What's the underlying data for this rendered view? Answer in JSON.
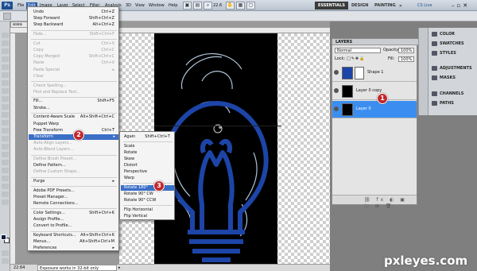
{
  "menubar": {
    "logo": "Ps",
    "items": [
      "File",
      "Edit",
      "Image",
      "Layer",
      "Select",
      "Filter",
      "Analysis",
      "3D",
      "View",
      "Window",
      "Help"
    ],
    "zoom": "22.6",
    "workspaces": [
      "ESSENTIALS",
      "DESIGN",
      "PAINTING"
    ],
    "cslive": "CS Live"
  },
  "document": {
    "tab": "asea",
    "status_zoom": "22.64",
    "status_text": "Exposure works in 32-bit only"
  },
  "edit_menu": {
    "items": [
      {
        "label": "Undo",
        "shortcut": "Ctrl+Z",
        "state": "normal"
      },
      {
        "label": "Step Forward",
        "shortcut": "Shift+Ctrl+Z",
        "state": "normal"
      },
      {
        "label": "Step Backward",
        "shortcut": "Alt+Ctrl+Z",
        "state": "normal"
      },
      {
        "label": "Fade...",
        "shortcut": "Shift+Ctrl+F",
        "state": "disabled"
      },
      {
        "label": "Cut",
        "shortcut": "Ctrl+X",
        "state": "disabled"
      },
      {
        "label": "Copy",
        "shortcut": "Ctrl+C",
        "state": "disabled"
      },
      {
        "label": "Copy Merged",
        "shortcut": "Shift+Ctrl+C",
        "state": "disabled"
      },
      {
        "label": "Paste",
        "shortcut": "Ctrl+V",
        "state": "disabled"
      },
      {
        "label": "Paste Special",
        "shortcut": "▸",
        "state": "disabled"
      },
      {
        "label": "Clear",
        "shortcut": "",
        "state": "disabled"
      },
      {
        "label": "Check Spelling...",
        "shortcut": "",
        "state": "disabled"
      },
      {
        "label": "Find and Replace Text...",
        "shortcut": "",
        "state": "disabled"
      },
      {
        "label": "Fill...",
        "shortcut": "Shift+F5",
        "state": "normal"
      },
      {
        "label": "Stroke...",
        "shortcut": "",
        "state": "normal"
      },
      {
        "label": "Content-Aware Scale",
        "shortcut": "Alt+Shift+Ctrl+C",
        "state": "normal"
      },
      {
        "label": "Puppet Warp",
        "shortcut": "",
        "state": "normal"
      },
      {
        "label": "Free Transform",
        "shortcut": "Ctrl+T",
        "state": "normal"
      },
      {
        "label": "Transform",
        "shortcut": "▸",
        "state": "highlight"
      },
      {
        "label": "Auto-Align Layers...",
        "shortcut": "",
        "state": "disabled"
      },
      {
        "label": "Auto-Blend Layers...",
        "shortcut": "",
        "state": "disabled"
      },
      {
        "label": "Define Brush Preset...",
        "shortcut": "",
        "state": "disabled"
      },
      {
        "label": "Define Pattern...",
        "shortcut": "",
        "state": "normal"
      },
      {
        "label": "Define Custom Shape...",
        "shortcut": "",
        "state": "disabled"
      },
      {
        "label": "Purge",
        "shortcut": "▸",
        "state": "normal"
      },
      {
        "label": "Adobe PDF Presets...",
        "shortcut": "",
        "state": "normal"
      },
      {
        "label": "Preset Manager...",
        "shortcut": "",
        "state": "normal"
      },
      {
        "label": "Remote Connections...",
        "shortcut": "",
        "state": "normal"
      },
      {
        "label": "Color Settings...",
        "shortcut": "Shift+Ctrl+K",
        "state": "normal"
      },
      {
        "label": "Assign Profile...",
        "shortcut": "",
        "state": "normal"
      },
      {
        "label": "Convert to Profile...",
        "shortcut": "",
        "state": "normal"
      },
      {
        "label": "Keyboard Shortcuts...",
        "shortcut": "Alt+Shift+Ctrl+K",
        "state": "normal"
      },
      {
        "label": "Menus...",
        "shortcut": "Alt+Shift+Ctrl+M",
        "state": "normal"
      },
      {
        "label": "Preferences",
        "shortcut": "▸",
        "state": "normal"
      }
    ]
  },
  "transform_menu": {
    "items": [
      {
        "label": "Again",
        "shortcut": "Shift+Ctrl+T",
        "state": "normal"
      },
      {
        "label": "Scale",
        "shortcut": "",
        "state": "normal"
      },
      {
        "label": "Rotate",
        "shortcut": "",
        "state": "normal"
      },
      {
        "label": "Skew",
        "shortcut": "",
        "state": "normal"
      },
      {
        "label": "Distort",
        "shortcut": "",
        "state": "normal"
      },
      {
        "label": "Perspective",
        "shortcut": "",
        "state": "normal"
      },
      {
        "label": "Warp",
        "shortcut": "",
        "state": "normal"
      },
      {
        "label": "Rotate 180°",
        "shortcut": "",
        "state": "highlight"
      },
      {
        "label": "Rotate 90° CW",
        "shortcut": "",
        "state": "normal"
      },
      {
        "label": "Rotate 90° CCW",
        "shortcut": "",
        "state": "normal"
      },
      {
        "label": "Flip Horizontal",
        "shortcut": "",
        "state": "normal"
      },
      {
        "label": "Flip Vertical",
        "shortcut": "",
        "state": "normal"
      }
    ]
  },
  "layers_panel": {
    "tab": "LAYERS",
    "blend_mode": "Normal",
    "opacity_label": "Opacity:",
    "opacity": "100%",
    "lock_label": "Lock:",
    "fill_label": "Fill:",
    "fill": "100%",
    "layers": [
      "Shape 1",
      "Layer 0 copy",
      "Layer 0"
    ]
  },
  "dock": {
    "items": [
      "COLOR",
      "SWATCHES",
      "STYLES",
      "ADJUSTMENTS",
      "MASKS",
      "CHANNELS",
      "PATHS"
    ]
  },
  "badges": [
    "1",
    "2",
    "3"
  ],
  "watermark": "pxleyes.com",
  "colors": {
    "highlight": "#3b6fc6",
    "badge": "#c0272d",
    "layer_selected": "#3b8ef0"
  }
}
